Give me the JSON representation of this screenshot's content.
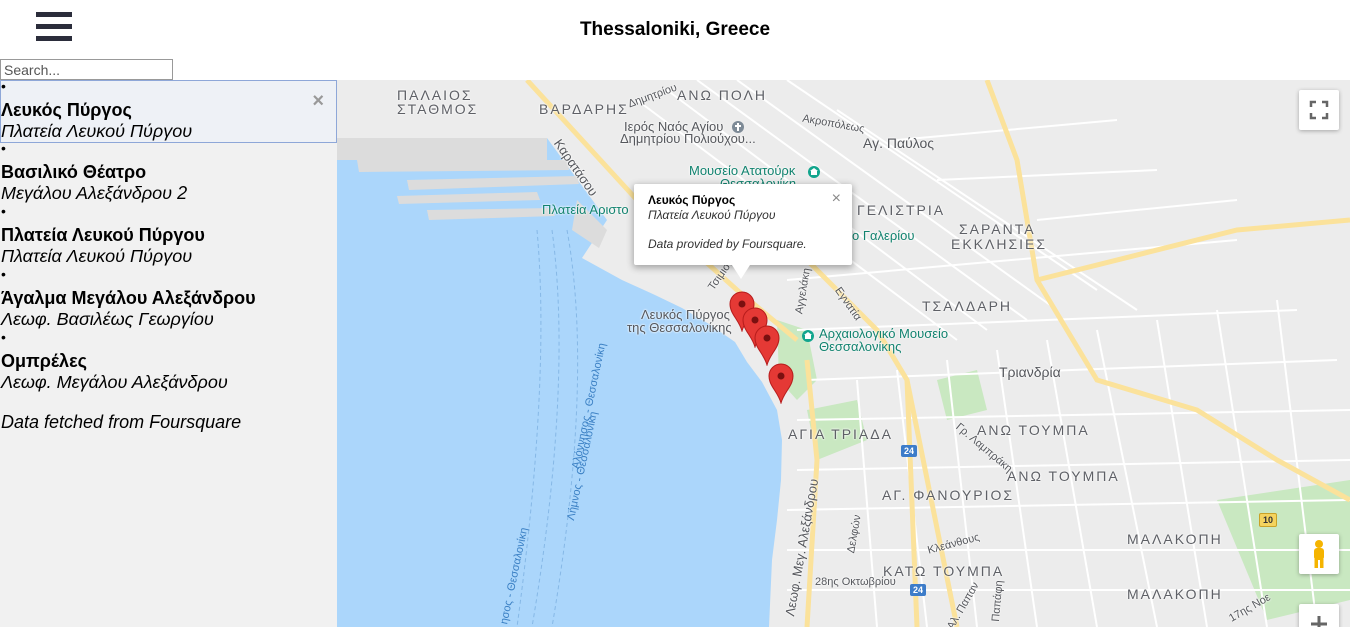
{
  "header": {
    "title": "Thessaloniki, Greece",
    "menu_icon": "hamburger-menu-icon"
  },
  "search": {
    "placeholder": "Search...",
    "value": ""
  },
  "places": [
    {
      "name": "Λευκός Πύργος",
      "address": "Πλατεία Λευκού Πύργου",
      "active": true
    },
    {
      "name": "Βασιλικό Θέατρο",
      "address": "Μεγάλου Αλεξάνδρου 2",
      "active": false
    },
    {
      "name": "Πλατεία Λευκού Πύργου",
      "address": "Πλατεία Λευκού Πύργου",
      "active": false
    },
    {
      "name": "Άγαλμα Μεγάλου Αλεξάνδρου",
      "address": "Λεωφ. Βασιλέως Γεωργίου",
      "active": false
    },
    {
      "name": "Ομπρέλες",
      "address": "Λεωφ. Μεγάλου Αλεξάνδρου",
      "active": false
    }
  ],
  "list_bullet": "•",
  "close_glyph": "×",
  "source_note": "Data fetched from Foursquare",
  "infowindow": {
    "name": "Λευκός Πύργος",
    "address": "Πλατεία Λευκού Πύργου",
    "credit": "Data provided by Foursquare."
  },
  "map": {
    "colors": {
      "sea": "#abd6fb",
      "land": "#ececec",
      "major_road": "#fbe29b",
      "park": "#c9e8c1",
      "marker": "#e53935"
    },
    "labels": {
      "palaios_stathmos_1": "ΠΑΛΑΙΟΣ",
      "palaios_stathmos_2": "ΣΤΑΘΜΟΣ",
      "vardaris": "ΒΑΡΔΑΡΗΣ",
      "ano_poli": "ΑΝΩ ΠΟΛΗ",
      "agios_dimitrios_1": "Ιερός Ναός Αγίου",
      "agios_dimitrios_2": "Δημητρίου Πολιούχου...",
      "akropoleos": "Ακροπόλεως",
      "ag_pavlos": "Αγ. Παύλος",
      "mouseio_ataturk_1": "Μουσείο Ατατούρκ",
      "mouseio_ataturk_2": "Θεσσαλονίκη",
      "plateia_aristotelous": "Πλατεία Αριστο",
      "karatasou": "Καρατάσου",
      "dimitriou": "Δημητρίου",
      "tsimiski": "Τσιμισκή",
      "evangelistria": "ΓΕΛΙΣΤΡΙΑ",
      "saranta_1": "ΣΑΡΑΝΤΑ",
      "saranta_2": "ΕΚΚΛΗΣΙΕΣ",
      "galeriou": "ο Γαλερίου",
      "tsaldari": "ΤΣΑΛΔΑΡΗ",
      "leukos_pyrgos_1": "Λευκός Πύργος",
      "leukos_pyrgos_2": "της Θεσσαλονίκης",
      "angelaki": "Αγγελάκη",
      "egnatia": "Εγνατία",
      "archaeological_1": "Αρχαιολογικό Μουσείο",
      "archaeological_2": "Θεσσαλονίκης",
      "triandria": "Τριανδρία",
      "agia_triada": "ΑΓΙΑ ΤΡΙΑΔΑ",
      "ano_toumpa_1": "ΑΝΩ ΤΟΥΜΠΑ",
      "ano_toumpa_2": "ΑΝΩ ΤΟΥΜΠΑ",
      "gr_lampraki": "Γρ. Λαμπράκη",
      "ag_fanourios": "ΑΓ. ΦΑΝΟΥΡΙΟΣ",
      "meg_alexandrou": "Λεωφ. Μεγ. Αλεξάνδρου",
      "delfon": "Δελφών",
      "kleanthous": "Κλεάνθους",
      "28_oktovriou": "28ης Οκτωβρίου",
      "kato_toumpa": "ΚΑΤΩ ΤΟΥΜΠΑ",
      "malakopi_1": "ΜΑΛΑΚΟΠΗ",
      "malakopi_2": "ΜΑΛΑΚΟΠΗ",
      "papanastasiou": "Αλ. Παπαν",
      "papafi": "Παπάφη",
      "17is_noemvriou": "17ης Νοε",
      "alonnisos": "Αλόννησος - Θεσσαλονίκη",
      "limnos": "Λήμνος - Θεσσαλονίκη",
      "sea_route": "ησος - Θεσσαλονίκη"
    },
    "route_shields": [
      "24",
      "24",
      "10"
    ],
    "controls": {
      "fullscreen_icon": "fullscreen-icon",
      "pegman_icon": "pegman-icon",
      "zoom_in_icon": "zoom-in-icon"
    },
    "marker_count": 5
  }
}
